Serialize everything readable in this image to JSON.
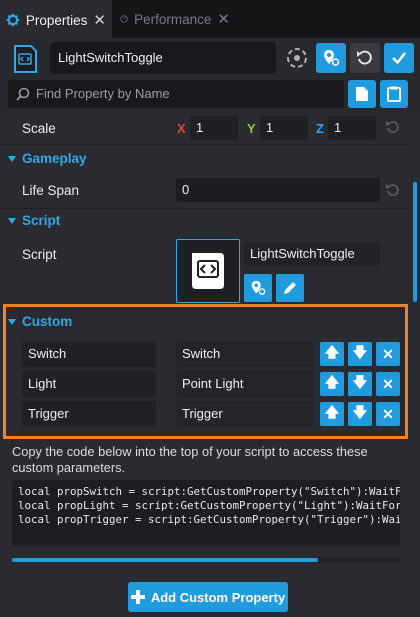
{
  "tabs": [
    {
      "label": "Properties",
      "icon": "gear-icon",
      "active": true
    },
    {
      "label": "Performance",
      "icon": "gauge-icon",
      "active": false
    }
  ],
  "header": {
    "object_name": "LightSwitchToggle",
    "search_placeholder": "Find Property by Name"
  },
  "transform": {
    "label": "Scale",
    "x_axis": "X",
    "x": "1",
    "y_axis": "Y",
    "y": "1",
    "z_axis": "Z",
    "z": "1"
  },
  "gameplay": {
    "title": "Gameplay",
    "life_span_label": "Life Span",
    "life_span": "0"
  },
  "script": {
    "title": "Script",
    "label": "Script",
    "asset_name": "LightSwitchToggle"
  },
  "custom": {
    "title": "Custom",
    "properties": [
      {
        "name": "Switch",
        "value": "Switch"
      },
      {
        "name": "Light",
        "value": "Point Light"
      },
      {
        "name": "Trigger",
        "value": "Trigger"
      }
    ]
  },
  "hint_text": "Copy the code below into the top of your script to access these custom parameters.",
  "code_lines": [
    "local propSwitch = script:GetCustomProperty(\"Switch\"):WaitForObject()",
    "local propLight = script:GetCustomProperty(\"Light\"):WaitForObject()",
    "local propTrigger = script:GetCustomProperty(\"Trigger\"):WaitForObject()"
  ],
  "add_button_label": "Add Custom Property",
  "colors": {
    "accent": "#1f9bde",
    "highlight": "#f58025",
    "axis_x": "#e0453d",
    "axis_y": "#8bc53f",
    "axis_z": "#2fa8e8"
  }
}
